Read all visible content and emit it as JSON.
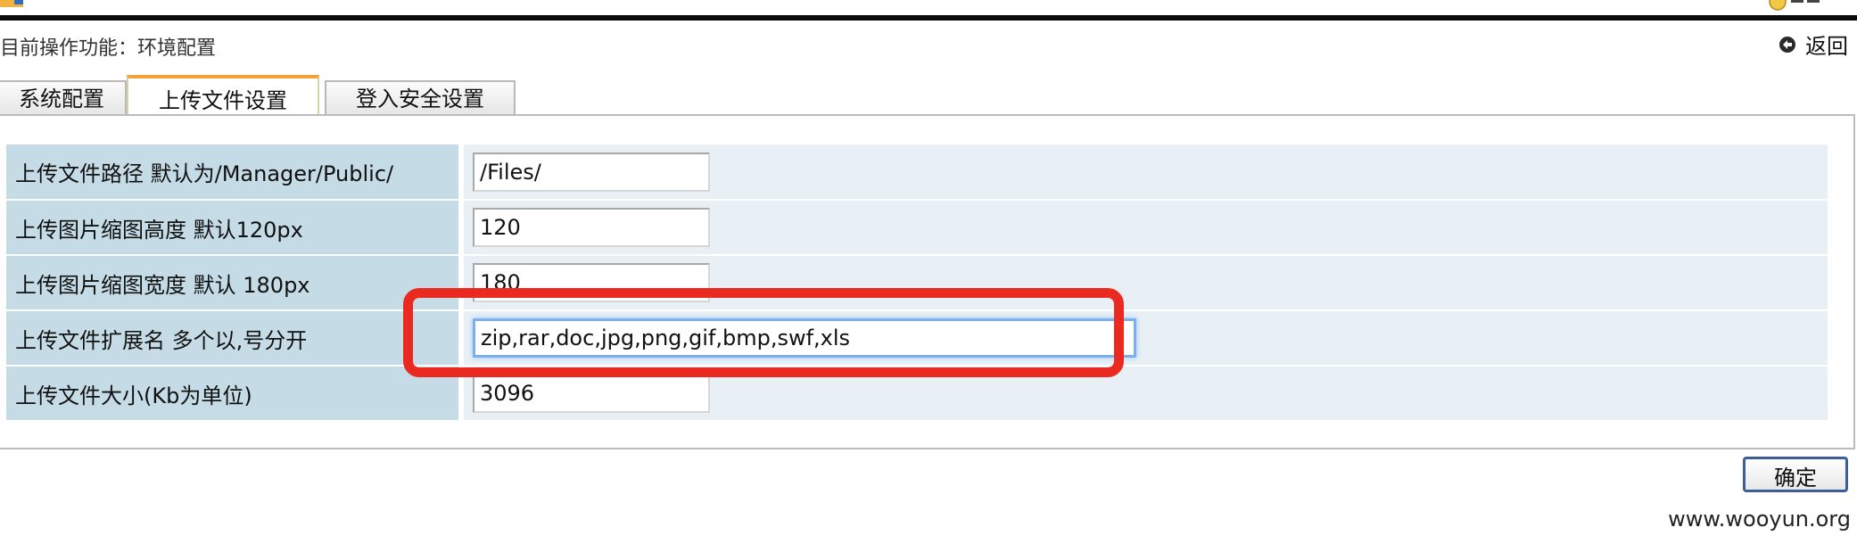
{
  "header": {
    "current_function": "目前操作功能：环境配置",
    "back_label": "返回"
  },
  "tabs": [
    {
      "label": "系统配置",
      "active": false
    },
    {
      "label": "上传文件设置",
      "active": true
    },
    {
      "label": "登入安全设置",
      "active": false
    }
  ],
  "form": {
    "rows": [
      {
        "label": "上传文件路径 默认为/Manager/Public/",
        "value": "/Files/"
      },
      {
        "label": "上传图片缩图高度 默认120px",
        "value": "120"
      },
      {
        "label": "上传图片缩图宽度 默认 180px",
        "value": "180"
      },
      {
        "label": "上传文件扩展名 多个以,号分开",
        "value": "zip,rar,doc,jpg,png,gif,bmp,swf,xls"
      },
      {
        "label": "上传文件大小(Kb为单位)",
        "value": "3096"
      }
    ]
  },
  "actions": {
    "confirm_label": "确定"
  },
  "watermark": "www.wooyun.org",
  "colors": {
    "label_bg": "#c5dbe6",
    "field_bg": "#e9f0f5",
    "active_tab_accent": "#f1a23a",
    "highlight_box": "#ea2a20",
    "button_border": "#3d5e97"
  },
  "icons": [
    "back-arrow-icon",
    "user-icon",
    "logo-icon"
  ]
}
